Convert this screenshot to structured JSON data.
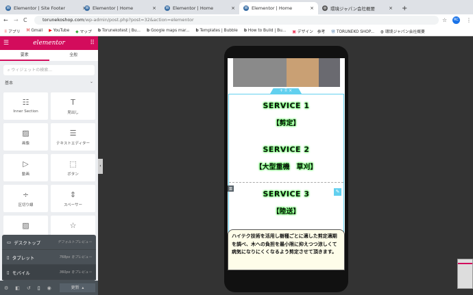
{
  "browser": {
    "tabs": [
      {
        "title": "Elementor | Site Footer"
      },
      {
        "title": "Elementor | Home"
      },
      {
        "title": "Elementor | Home"
      },
      {
        "title": "Elementor | Home",
        "active": true
      },
      {
        "title": "環境ジャパン会社概要"
      }
    ],
    "url_host": "torunekoshop.com",
    "url_path": "/wp-admin/post.php?post=32&action=elementor",
    "avatar": "RC",
    "bookmarks": [
      "アプリ",
      "Gmail",
      "YouTube",
      "マップ",
      "Torunekotest | Bu...",
      "Google maps mar...",
      "Templates | Bubble",
      "How to Build | Bu...",
      "デザイン　参考",
      "TORUNEKO SHOP...",
      "環境ジャパン会社概要"
    ]
  },
  "sidebar": {
    "logo": "elementor",
    "tabs": [
      "要素",
      "全般"
    ],
    "search_placeholder": "ウィジェットの検索...",
    "category": "基本",
    "widgets": [
      {
        "label": "Inner Section",
        "icon": "☷"
      },
      {
        "label": "見出し",
        "icon": "T"
      },
      {
        "label": "画像",
        "icon": "▨"
      },
      {
        "label": "テキストエディター",
        "icon": "☰"
      },
      {
        "label": "動画",
        "icon": "▷"
      },
      {
        "label": "ボタン",
        "icon": "⬚"
      },
      {
        "label": "区切り線",
        "icon": "÷"
      },
      {
        "label": "スペーサー",
        "icon": "⇕"
      },
      {
        "label": "",
        "icon": "▨"
      },
      {
        "label": "",
        "icon": "☆"
      }
    ],
    "responsive": [
      {
        "label": "デスクトップ",
        "hint": "デフォルトプレビュー",
        "icon": "▭"
      },
      {
        "label": "タブレット",
        "hint": "768px をプレビュー",
        "icon": "▯"
      },
      {
        "label": "モバイル",
        "hint": "360px をプレビュー",
        "icon": "▯"
      }
    ],
    "update": "更新"
  },
  "canvas": {
    "services": [
      {
        "title": "SERVICE 1",
        "sub": "【剪定】"
      },
      {
        "title": "SERVICE 2",
        "sub": "【大型重機　草刈】"
      },
      {
        "title": "SERVICE 3",
        "sub": "【陸送】"
      }
    ],
    "description": "ハイテク技術を活用し樹種ごとに適した剪定適期を調べ、木への負担を最小限に抑えつつ涼しくて病気になりにくくなるよう剪定させて頂きます。"
  }
}
